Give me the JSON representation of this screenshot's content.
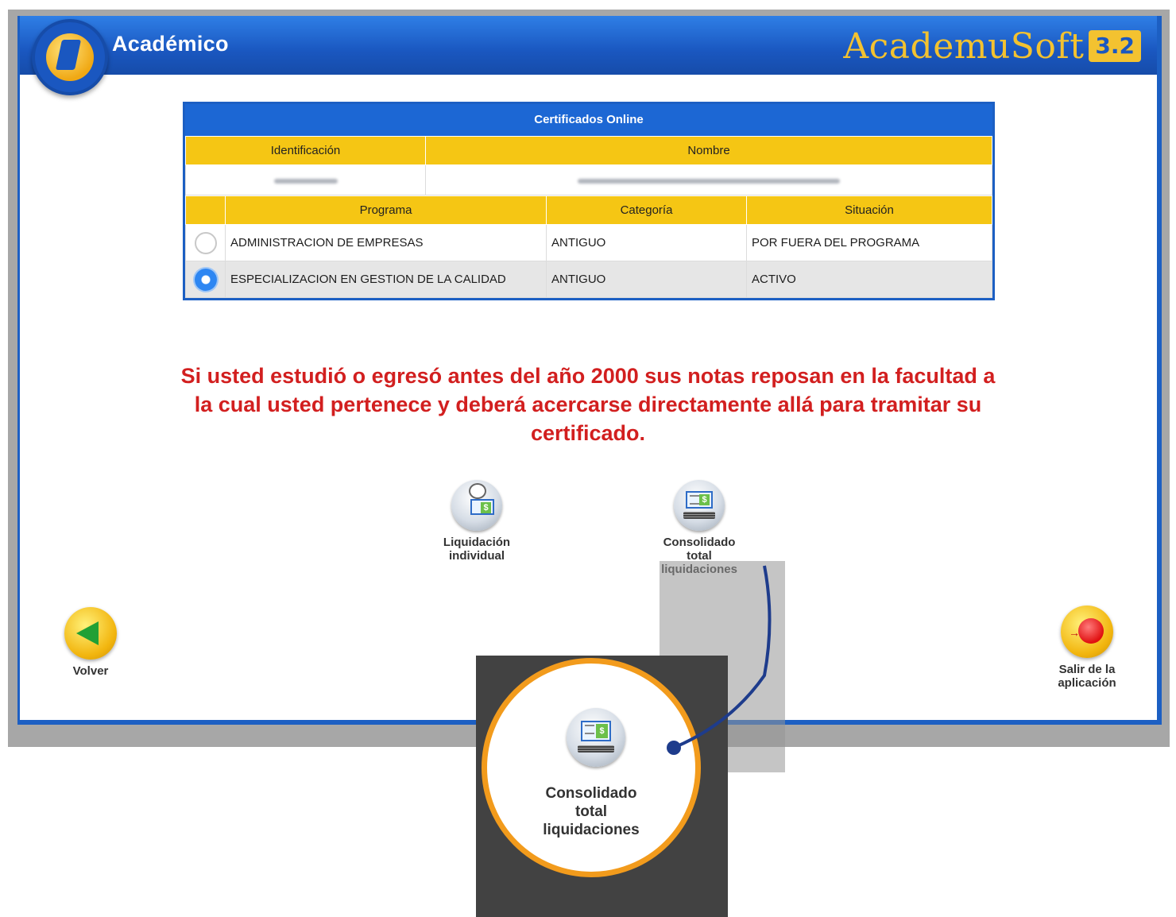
{
  "app": {
    "title": "Académico",
    "brand_name": "AcademuSoft",
    "brand_version": "3.2"
  },
  "table": {
    "header": "Certificados Online",
    "col_identificacion": "Identificación",
    "col_nombre": "Nombre",
    "col_programa": "Programa",
    "col_categoria": "Categoría",
    "col_situacion": "Situación",
    "rows": [
      {
        "programa": "ADMINISTRACION DE EMPRESAS",
        "categoria": "ANTIGUO",
        "situacion": "POR FUERA DEL PROGRAMA",
        "selected": false
      },
      {
        "programa": "ESPECIALIZACION EN GESTION DE LA CALIDAD",
        "categoria": "ANTIGUO",
        "situacion": "ACTIVO",
        "selected": true
      }
    ]
  },
  "notice": "Si usted estudió o egresó antes del año 2000 sus notas reposan en la facultad a la cual usted pertenece y deberá acercarse directamente allá para tramitar su certificado.",
  "actions": {
    "liquidacion_line1": "Liquidación",
    "liquidacion_line2": "individual",
    "consolidado_line1": "Consolidado",
    "consolidado_line2": "total",
    "consolidado_line3": "liquidaciones"
  },
  "nav": {
    "back_label": "Volver",
    "exit_line1": "Salir de la",
    "exit_line2": "aplicación"
  },
  "callout": {
    "line1": "Consolidado",
    "line2": "total",
    "line3": "liquidaciones"
  },
  "colors": {
    "primary_blue": "#1c5fc3",
    "header_yellow": "#f5c614",
    "notice_red": "#d21f1f",
    "callout_orange": "#f29b1c"
  }
}
